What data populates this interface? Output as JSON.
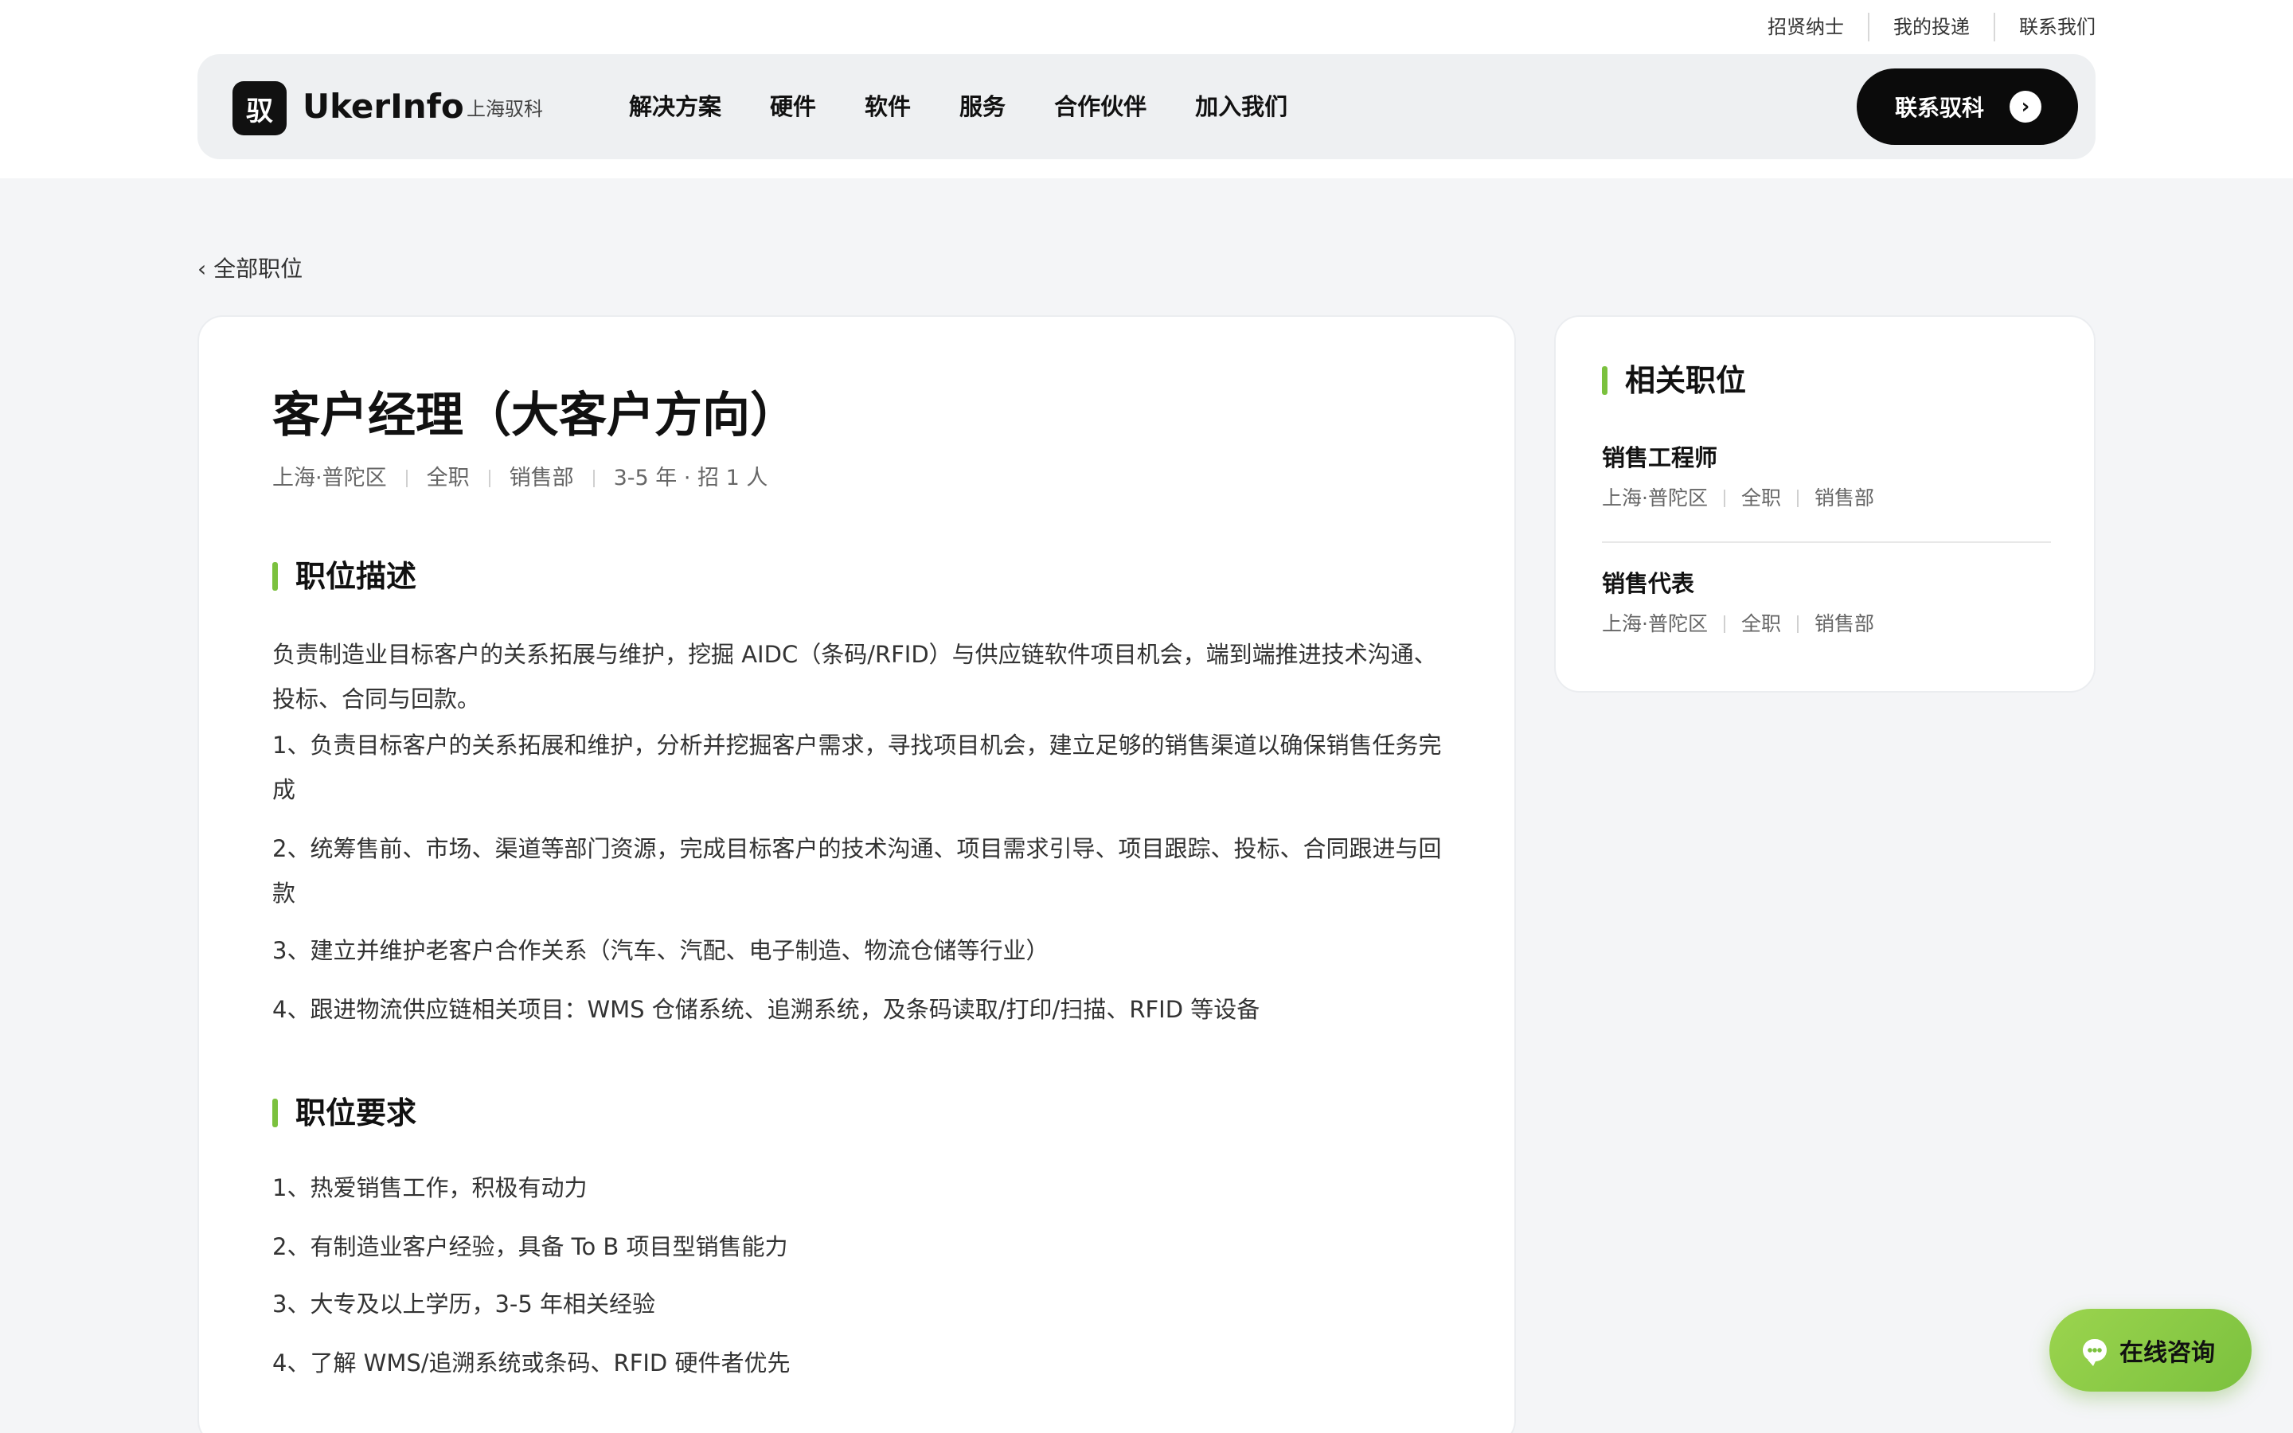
{
  "utility_nav": [
    "招贤纳士",
    "我的投递",
    "联系我们"
  ],
  "brand": {
    "logo_char": "驭",
    "name": "UkerInfo",
    "sub": "上海驭科"
  },
  "nav": [
    "解决方案",
    "硬件",
    "软件",
    "服务",
    "合作伙伴",
    "加入我们"
  ],
  "cta": {
    "label": "联系驭科",
    "arrow": "›"
  },
  "back_link": "‹ 全部职位",
  "job": {
    "title": "客户经理（大客户方向）",
    "meta": [
      "上海·普陀区",
      "全职",
      "销售部",
      "3-5 年 · 招 1 人"
    ],
    "description_heading": "职位描述",
    "description_intro": "负责制造业目标客户的关系拓展与维护，挖掘 AIDC（条码/RFID）与供应链软件项目机会，端到端推进技术沟通、投标、合同与回款。",
    "description_items": [
      "1、负责目标客户的关系拓展和维护，分析并挖掘客户需求，寻找项目机会，建立足够的销售渠道以确保销售任务完成",
      "2、统筹售前、市场、渠道等部门资源，完成目标客户的技术沟通、项目需求引导、项目跟踪、投标、合同跟进与回款",
      "3、建立并维护老客户合作关系（汽车、汽配、电子制造、物流仓储等行业）",
      "4、跟进物流供应链相关项目：WMS 仓储系统、追溯系统，及条码读取/打印/扫描、RFID 等设备"
    ],
    "requirements_heading": "职位要求",
    "requirement_items": [
      "1、热爱销售工作，积极有动力",
      "2、有制造业客户经验，具备 To B 项目型销售能力",
      "3、大专及以上学历，3-5 年相关经验",
      "4、了解 WMS/追溯系统或条码、RFID 硬件者优先"
    ]
  },
  "related": {
    "heading": "相关职位",
    "items": [
      {
        "title": "销售工程师",
        "meta": [
          "上海·普陀区",
          "全职",
          "销售部"
        ]
      },
      {
        "title": "销售代表",
        "meta": [
          "上海·普陀区",
          "全职",
          "销售部"
        ]
      }
    ]
  },
  "chat": {
    "label": "在线咨询",
    "icon": "chat-bubble-icon"
  },
  "colors": {
    "accent": "#7bc13e",
    "dark": "#0b0b0b",
    "background": "#f4f5f7"
  }
}
